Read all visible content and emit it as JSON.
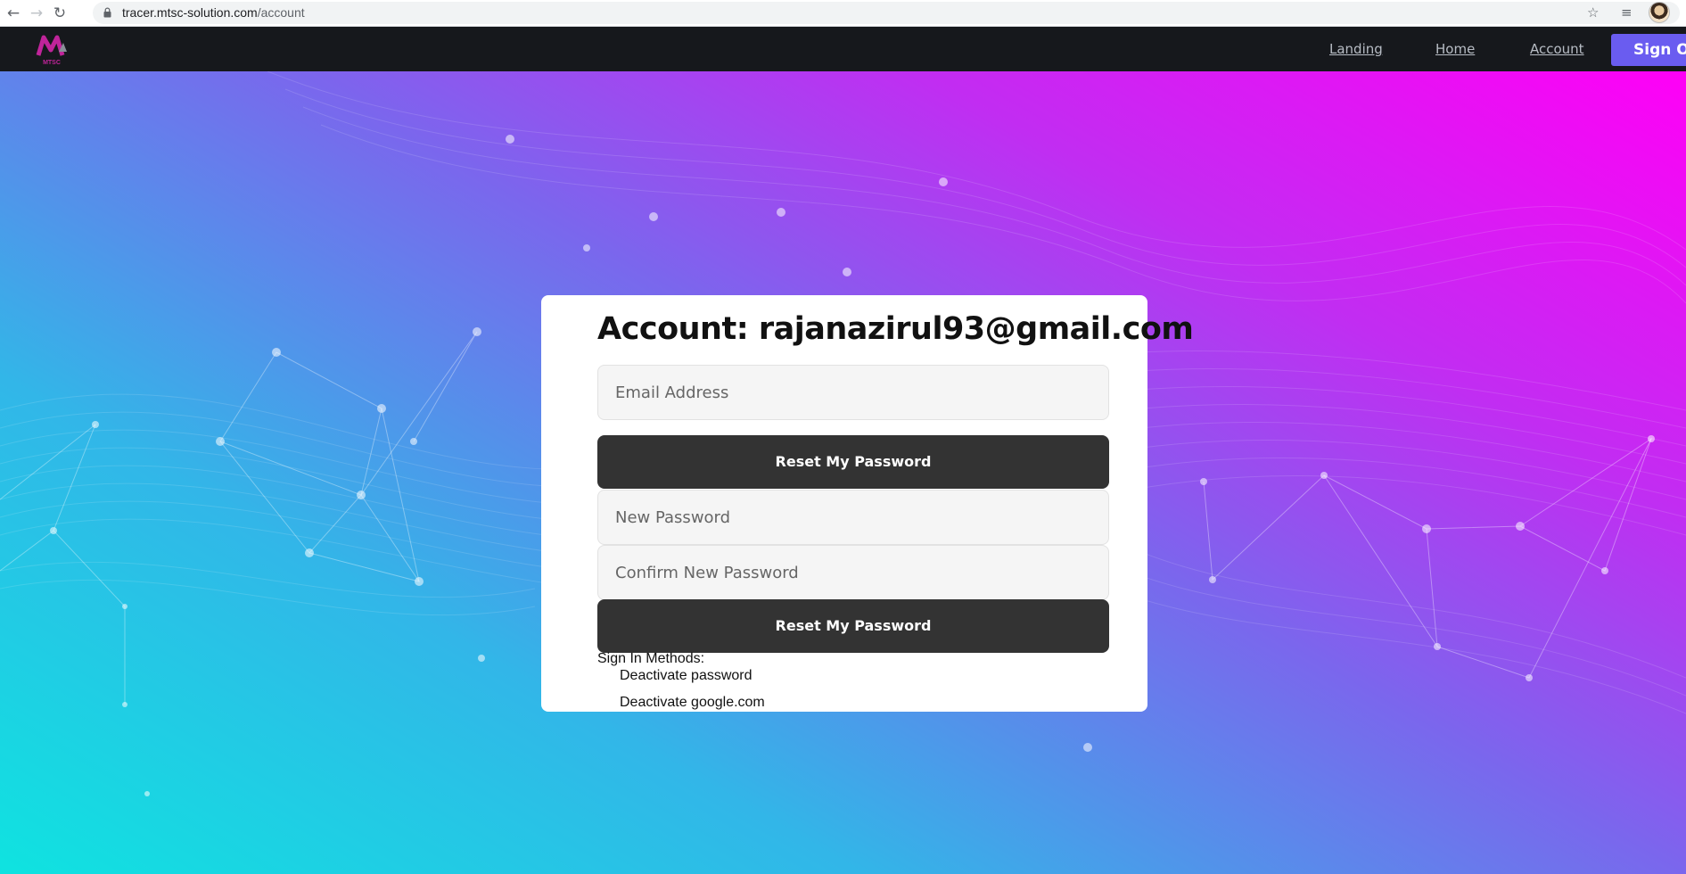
{
  "browser": {
    "url_host": "tracer.mtsc-solution.com",
    "url_path": "/account"
  },
  "nav": {
    "logo_text": "MTSC",
    "links": [
      "Landing",
      "Home",
      "Account"
    ],
    "sign_out_label": "Sign Ou"
  },
  "account": {
    "title": "Account: rajanazirul93@gmail.com",
    "email_placeholder": "Email Address",
    "reset_button_1": "Reset My Password",
    "new_password_placeholder": "New Password",
    "confirm_password_placeholder": "Confirm New Password",
    "reset_button_2": "Reset My Password",
    "sign_in_methods_label": "Sign In Methods:",
    "methods": [
      "Deactivate password",
      "Deactivate google.com"
    ]
  },
  "colors": {
    "nav_bg": "#16181c",
    "sign_out_bg": "#6a5cf0",
    "button_bg": "#333333",
    "gradient_start": "#0fe3e0",
    "gradient_end": "#ff00f6"
  }
}
